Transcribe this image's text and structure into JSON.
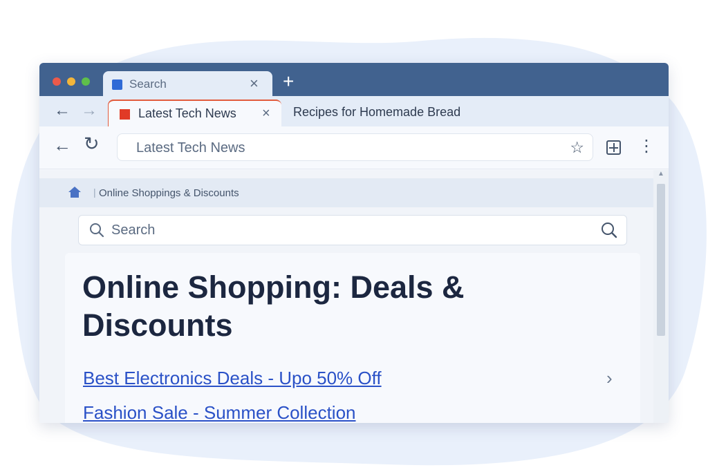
{
  "window_titlebar": {
    "tab_label": "Search",
    "tab_close": "×",
    "new_tab": "+"
  },
  "tabstrip": {
    "back": "←",
    "forward": "→",
    "active_tab": {
      "label": "Latest Tech News",
      "close": "×"
    },
    "other_tab": {
      "label": "Recipes for Homemade Bread"
    }
  },
  "toolbar": {
    "back": "←",
    "reload": "↻",
    "address_text": "Latest Tech News",
    "star": "☆",
    "menu": "⋮"
  },
  "breadcrumb": {
    "separator": "|",
    "text": "Online Shoppings & Discounts"
  },
  "search": {
    "placeholder": "Search"
  },
  "main": {
    "title": "Online Shopping: Deals & Discounts",
    "links": [
      {
        "label": "Best Electronics Deals - Upo 50% Off"
      },
      {
        "label": "Fashion Sale - Summer Collection"
      }
    ],
    "chevron": "›"
  },
  "icons": {
    "home": "home-icon",
    "search": "search-icon",
    "extension": "extension-icon",
    "star": "star-icon",
    "menu": "kebab-menu-icon"
  },
  "colors": {
    "titlebar": "#41628f",
    "active_tab_accent": "#e25b3c",
    "link": "#2a51c7",
    "heading": "#1c2740"
  }
}
